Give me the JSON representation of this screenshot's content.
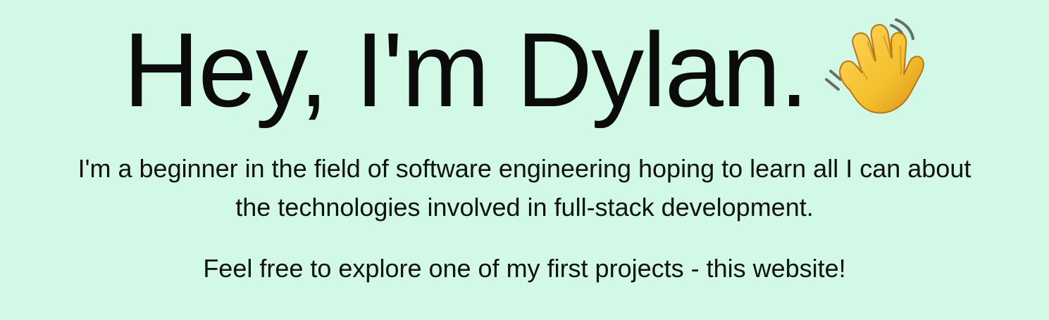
{
  "hero": {
    "headline": "Hey, I'm Dylan.",
    "headline_icon": "waving-hand-icon",
    "bio_line_1": "I'm a beginner in the field of software engineering hoping to learn all I can about",
    "bio_line_2": "the technologies involved in full-stack development.",
    "invite": "Feel free to explore one of my first projects - this website!"
  },
  "colors": {
    "background": "#d1f9e6",
    "text": "#111111",
    "wave_hand": "#f3bf2c",
    "wave_motion": "#6b6b6b"
  }
}
